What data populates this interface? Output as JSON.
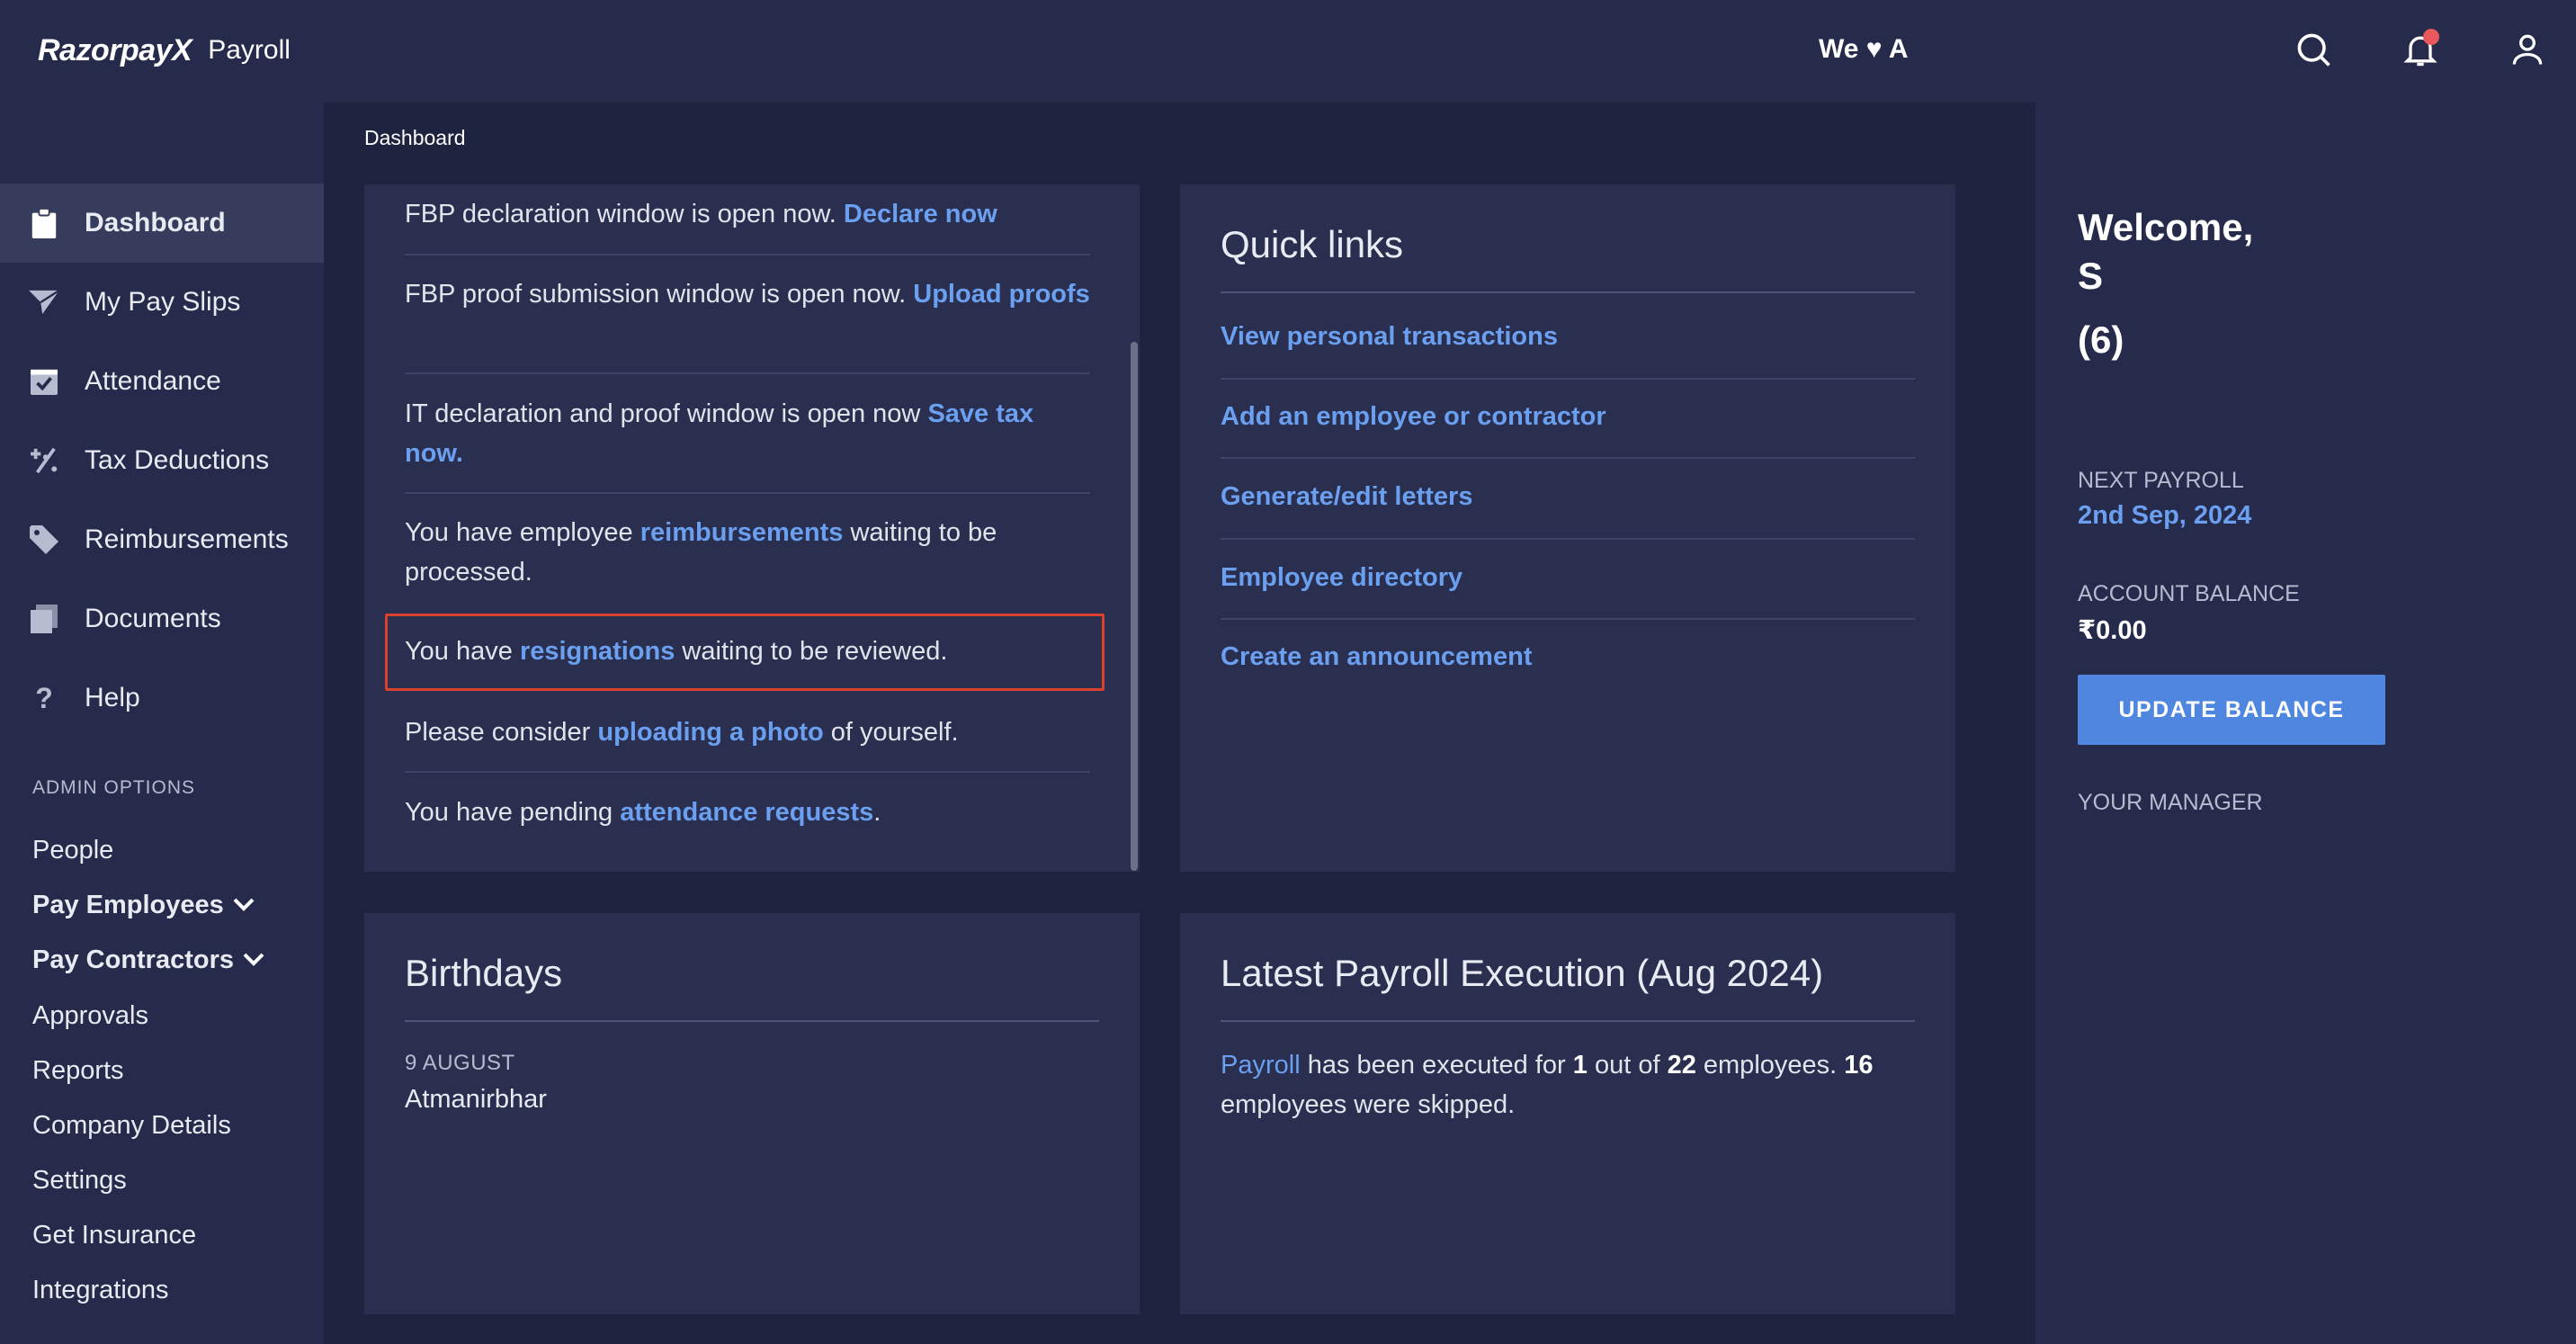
{
  "header": {
    "brand": "RazorpayX",
    "product": "Payroll",
    "tagline": "We ♥ A"
  },
  "sidebar": {
    "items": [
      {
        "label": "Dashboard",
        "icon": "clipboard-icon",
        "active": true
      },
      {
        "label": "My Pay Slips",
        "icon": "paper-plane-icon"
      },
      {
        "label": "Attendance",
        "icon": "calendar-check-icon"
      },
      {
        "label": "Tax Deductions",
        "icon": "percent-icon"
      },
      {
        "label": "Reimbursements",
        "icon": "tag-icon"
      },
      {
        "label": "Documents",
        "icon": "documents-icon"
      },
      {
        "label": "Help",
        "icon": "question-icon"
      }
    ],
    "admin_title": "ADMIN OPTIONS",
    "admin_items": [
      {
        "label": "People"
      },
      {
        "label": "Pay Employees",
        "expandable": true
      },
      {
        "label": "Pay Contractors",
        "expandable": true
      },
      {
        "label": "Approvals"
      },
      {
        "label": "Reports"
      },
      {
        "label": "Company Details"
      },
      {
        "label": "Settings"
      },
      {
        "label": "Get Insurance"
      },
      {
        "label": "Integrations"
      }
    ]
  },
  "breadcrumb": "Dashboard",
  "notices": [
    {
      "pre": "FBP declaration window is open now. ",
      "link": "Declare now",
      "post": ""
    },
    {
      "pre": "FBP proof submission window is open now. ",
      "link": "Upload proofs",
      "post": ""
    },
    {
      "pre": "IT declaration and proof window is open now ",
      "link": "Save tax now.",
      "post": ""
    },
    {
      "pre": "You have employee ",
      "link": "reimbursements",
      "post": " waiting to be processed."
    },
    {
      "pre": "You have ",
      "link": "resignations",
      "post": " waiting to be reviewed."
    },
    {
      "pre": "Please consider ",
      "link": "uploading a photo",
      "post": " of yourself."
    },
    {
      "pre": "You have pending ",
      "link": "attendance requests",
      "post": "."
    }
  ],
  "quick_links": {
    "title": "Quick links",
    "links": [
      "View personal transactions",
      "Add an employee or contractor",
      "Generate/edit letters",
      "Employee directory",
      "Create an announcement"
    ]
  },
  "birthdays": {
    "title": "Birthdays",
    "date": "9 AUGUST",
    "name": "Atmanirbhar"
  },
  "latest_payroll": {
    "title": "Latest Payroll Execution (Aug 2024)",
    "link": "Payroll",
    "t1": " has been executed for ",
    "executed": "1",
    "t2": " out of ",
    "total": "22",
    "t3": " employees. ",
    "skipped": "16",
    "t4": " employees were skipped."
  },
  "right_panel": {
    "welcome_line1": "Welcome,",
    "welcome_line2": "S",
    "count": "(6)",
    "next_payroll_label": "NEXT PAYROLL",
    "next_payroll_value": "2nd Sep, 2024",
    "balance_label": "ACCOUNT BALANCE",
    "balance_value": "₹0.00",
    "update_button": "UPDATE BALANCE",
    "manager_label": "YOUR MANAGER"
  },
  "colors": {
    "background": "#1e2340",
    "panel": "#262b4c",
    "card": "#2a2f50",
    "link": "#6b9ff0",
    "accent_button": "#4f86e0",
    "notification_dot": "#e8585c",
    "highlight_border": "#d9402f"
  }
}
